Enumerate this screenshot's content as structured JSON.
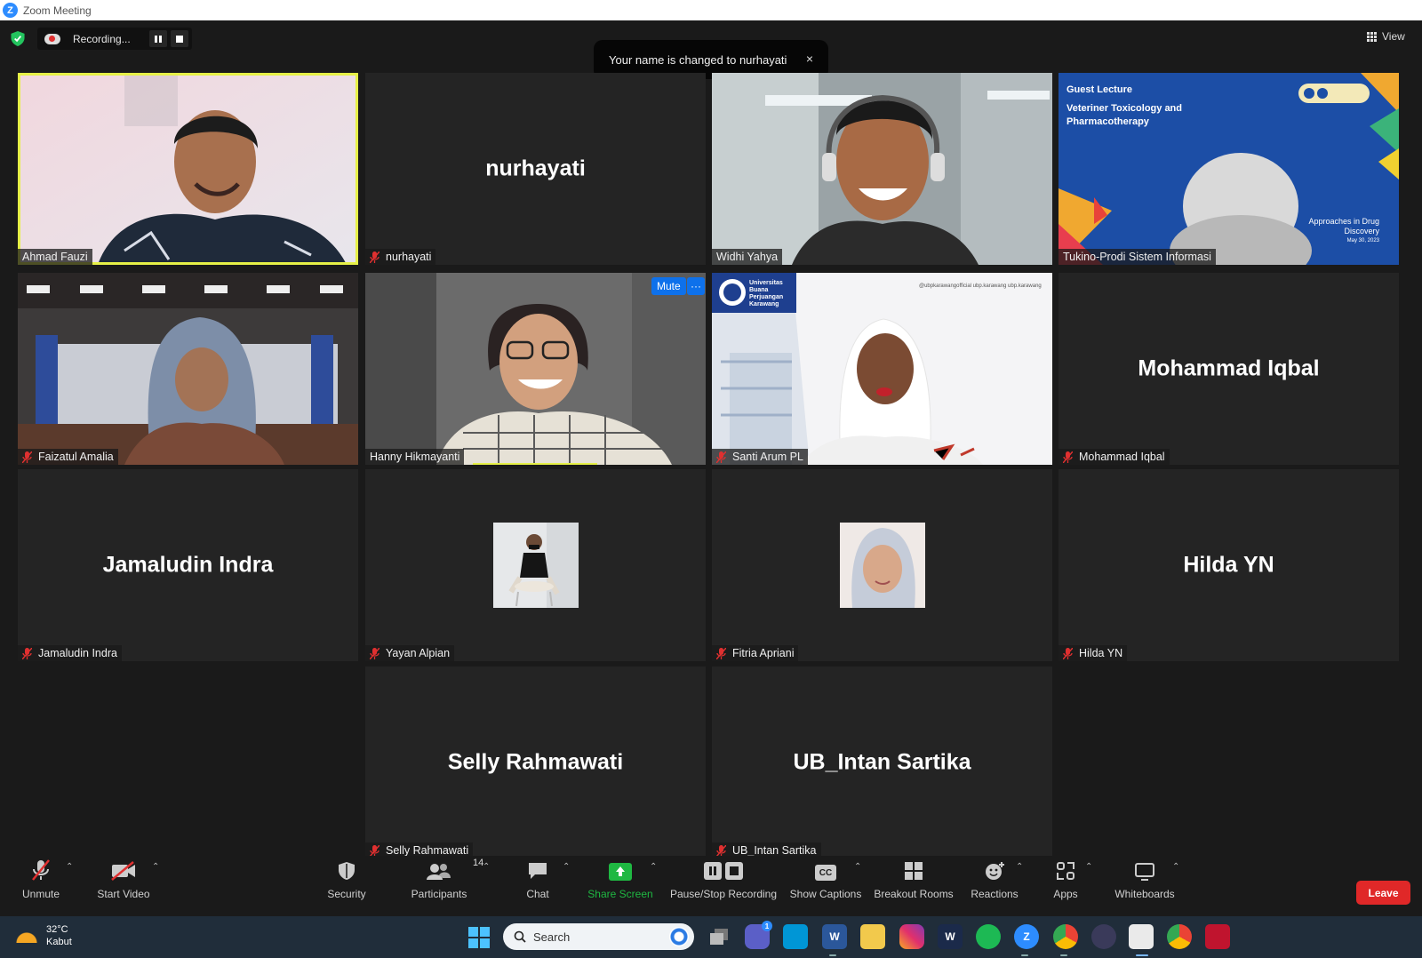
{
  "window": {
    "title": "Zoom Meeting"
  },
  "recording": {
    "status": "Recording..."
  },
  "notification": {
    "text": "Your name is changed to nurhayati",
    "close": "×"
  },
  "view_button": {
    "label": "View"
  },
  "tile_actions": {
    "mute": "Mute",
    "more": "···"
  },
  "participants": [
    {
      "name": "Ahmad Fauzi",
      "video": true,
      "active_speaker": true,
      "muted": false
    },
    {
      "name": "nurhayati",
      "video": false,
      "muted": true
    },
    {
      "name": "Widhi Yahya",
      "video": true,
      "muted": false
    },
    {
      "name": "Tukino-Prodi Sistem Informasi",
      "video": true,
      "muted": false
    },
    {
      "name": "Faizatul Amalia",
      "video": true,
      "muted": true
    },
    {
      "name": "Hanny Hikmayanti",
      "video": true,
      "muted": false
    },
    {
      "name": "Santi Arum PL",
      "video": true,
      "muted": true
    },
    {
      "name": "Mohammad Iqbal",
      "video": false,
      "muted": true
    },
    {
      "name": "Jamaludin Indra",
      "video": false,
      "muted": true
    },
    {
      "name": "Yayan Alpian",
      "video": false,
      "has_avatar": true,
      "muted": true
    },
    {
      "name": "Fitria Apriani",
      "video": false,
      "has_avatar": true,
      "muted": true
    },
    {
      "name": "Hilda YN",
      "video": false,
      "muted": true
    },
    {
      "name": "Selly Rahmawati",
      "video": false,
      "muted": true
    },
    {
      "name": "UB_Intan Sartika",
      "video": false,
      "muted": true
    }
  ],
  "slide": {
    "heading": "Guest Lecture",
    "title_line1": "Veteriner Toxicology and",
    "title_line2": "Pharmacotherapy",
    "sub_line1": "Approaches in Drug",
    "sub_line2": "Discovery",
    "date": "May 30, 2023"
  },
  "santi_bg": {
    "logo_text1": "Universitas",
    "logo_text2": "Buana",
    "logo_text3": "Perjuangan",
    "logo_text4": "Karawang",
    "social": "@ubpkarawangofficial   ubp.karawang   ubp.karawang"
  },
  "toolbar": {
    "unmute": "Unmute",
    "start_video": "Start Video",
    "security": "Security",
    "participants": "Participants",
    "participants_count": "14",
    "chat": "Chat",
    "share_screen": "Share Screen",
    "pause_stop": "Pause/Stop Recording",
    "captions": "Show Captions",
    "captions_icon": "CC",
    "breakout": "Breakout Rooms",
    "reactions": "Reactions",
    "apps": "Apps",
    "whiteboards": "Whiteboards",
    "leave": "Leave"
  },
  "taskbar": {
    "temperature": "32°C",
    "weather": "Kabut",
    "search_placeholder": "Search",
    "teams_badge": "1"
  },
  "colors": {
    "active_speaker": "#e6f047",
    "share_green": "#1fb842",
    "leave_red": "#e02828",
    "mute_blue": "#0e71eb",
    "muted_icon": "#e03030"
  }
}
